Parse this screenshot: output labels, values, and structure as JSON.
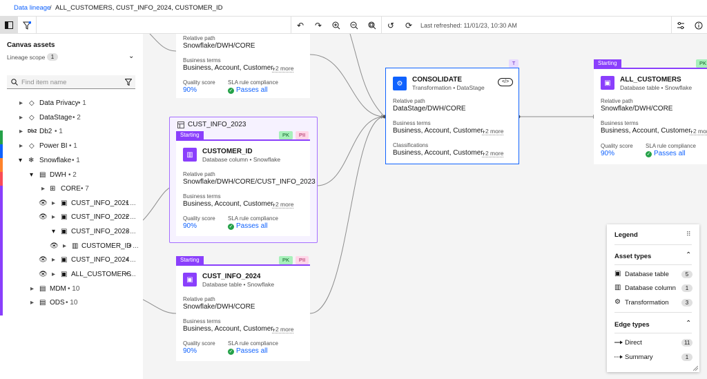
{
  "breadcrumb": {
    "root": "Data lineage",
    "separator": "/",
    "current": "ALL_CUSTOMERS, CUST_INFO_2024, CUSTOMER_ID"
  },
  "toolbar": {
    "last_refreshed": "Last refreshed: 11/01/23, 10:30 AM"
  },
  "sidebar": {
    "title": "Canvas assets",
    "scope_label": "Lineage scope",
    "scope_count": "1",
    "search_placeholder": "Find item name",
    "tree": [
      {
        "label": "Data Privacy",
        "count": "1"
      },
      {
        "label": "DataStage",
        "count": "2"
      },
      {
        "label": "Db2",
        "count": "1",
        "icon_text": "Db2"
      },
      {
        "label": "Power BI",
        "count": "1"
      },
      {
        "label": "Snowflake",
        "count": "1"
      },
      {
        "label": "DWH",
        "count": "2"
      },
      {
        "label": "CORE",
        "count": "7"
      },
      {
        "label": "CUST_INFO_2021",
        "count": "..."
      },
      {
        "label": "CUST_INFO_2022",
        "count": "..."
      },
      {
        "label": "CUST_INFO_2023",
        "count": "..."
      },
      {
        "label": "CUSTOMER_ID",
        "count": "..."
      },
      {
        "label": "CUST_INFO_2024",
        "count": "..."
      },
      {
        "label": "ALL_CUSTOMERS",
        "count": "..."
      },
      {
        "label": "MDM",
        "count": "10"
      },
      {
        "label": "ODS",
        "count": "10"
      }
    ],
    "colors": [
      "#24a148",
      "#0f62fe",
      "#fa4d56",
      "#8a3ffc"
    ]
  },
  "common": {
    "relative_path_label": "Relative path",
    "business_terms_label": "Business terms",
    "business_terms_value": "Business, Account, Customer,",
    "more": "+2 more",
    "quality_label": "Quality score",
    "sla_label": "SLA rule compliance",
    "quality_value": "90%",
    "sla_value": "Passes all",
    "starting": "Starting",
    "pk": "PK",
    "pii": "PII",
    "classifications_label": "Classifications",
    "classifications_value": "Business, Account, Customer,",
    "t_tag": "T"
  },
  "cards": {
    "top": {
      "path": "Snowflake/DWH/CORE"
    },
    "group": {
      "title": "CUST_INFO_2023"
    },
    "customer_id": {
      "title": "CUSTOMER_ID",
      "subtitle": "Database column • Snowflake",
      "path": "Snowflake/DWH/CORE/CUST_INFO_2023"
    },
    "cust2024": {
      "title": "CUST_INFO_2024",
      "subtitle": "Database table • Snowflake",
      "path": "Snowflake/DWH/CORE"
    },
    "consolidate": {
      "title": "CONSOLIDATE",
      "subtitle": "Transformation • DataStage",
      "path": "DataStage/DWH/CORE"
    },
    "all_customers": {
      "title": "ALL_CUSTOMERS",
      "subtitle": "Database table • Snowflake",
      "path": "Snowflake/DWH/CORE"
    }
  },
  "legend": {
    "title": "Legend",
    "asset_types_title": "Asset types",
    "asset_types": [
      {
        "label": "Database table",
        "count": "5"
      },
      {
        "label": "Database column",
        "count": "1"
      },
      {
        "label": "Transformation",
        "count": "3"
      }
    ],
    "edge_types_title": "Edge types",
    "edge_types": [
      {
        "label": "Direct",
        "count": "11"
      },
      {
        "label": "Summary",
        "count": "1"
      }
    ]
  }
}
